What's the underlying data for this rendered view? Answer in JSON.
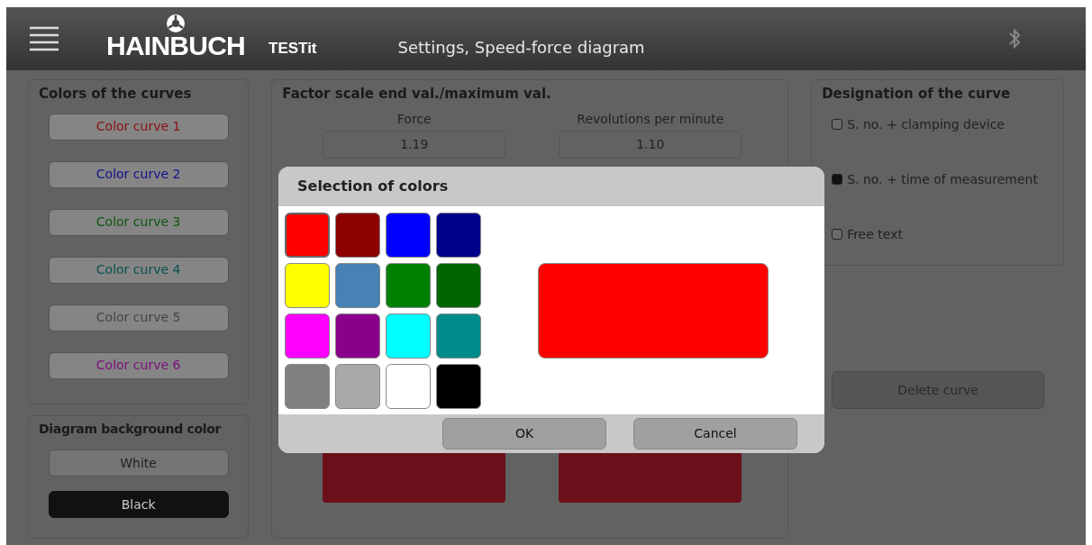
{
  "header": {
    "brand": "HAINBUCH",
    "product": "TESTit",
    "title": "Settings, Speed-force diagram"
  },
  "curve_colors": {
    "title": "Colors of the curves",
    "buttons": [
      {
        "label": "Color curve 1",
        "color": "#8a1010"
      },
      {
        "label": "Color curve 2",
        "color": "#12128a"
      },
      {
        "label": "Color curve 3",
        "color": "#0d560d"
      },
      {
        "label": "Color curve 4",
        "color": "#0a5050"
      },
      {
        "label": "Color curve 5",
        "color": "#454545"
      },
      {
        "label": "Color curve 6",
        "color": "#7a107a"
      }
    ]
  },
  "background_color": {
    "title": "Diagram background color",
    "options": [
      {
        "label": "White",
        "selected": false
      },
      {
        "label": "Black",
        "selected": true
      }
    ]
  },
  "factor": {
    "title": "Factor scale end val./maximum val.",
    "fields": [
      {
        "label": "Force",
        "value": "1.19"
      },
      {
        "label": "Revolutions per minute",
        "value": "1.10"
      }
    ]
  },
  "designation": {
    "title": "Designation of the curve",
    "options": [
      {
        "label": "S. no. + clamping device",
        "checked": false
      },
      {
        "label": "S. no. + time of measurement",
        "checked": true
      },
      {
        "label": "Free text",
        "checked": false
      }
    ],
    "delete_button": "Delete curve"
  },
  "dialog": {
    "title": "Selection of colors",
    "swatches": [
      {
        "color": "#ff0000",
        "selected": true
      },
      {
        "color": "#8b0000",
        "selected": false
      },
      {
        "color": "#0000ff",
        "selected": false
      },
      {
        "color": "#00008b",
        "selected": false
      },
      {
        "color": "#ffff00",
        "selected": false
      },
      {
        "color": "#4682b4",
        "selected": false
      },
      {
        "color": "#008000",
        "selected": false
      },
      {
        "color": "#006400",
        "selected": false
      },
      {
        "color": "#ff00ff",
        "selected": false
      },
      {
        "color": "#8b008b",
        "selected": false
      },
      {
        "color": "#00ffff",
        "selected": false
      },
      {
        "color": "#008b8b",
        "selected": false
      },
      {
        "color": "#808080",
        "selected": false
      },
      {
        "color": "#a9a9a9",
        "selected": false
      },
      {
        "color": "#ffffff",
        "selected": false
      },
      {
        "color": "#000000",
        "selected": false
      }
    ],
    "buttons": [
      "OK",
      "Cancel"
    ]
  }
}
